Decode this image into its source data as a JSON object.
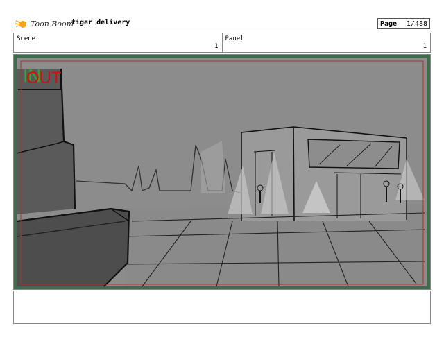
{
  "header": {
    "logo_text": "Toon Boom",
    "project_title": "tiger delivery",
    "page_label": "Page",
    "page_value": "1/488"
  },
  "info": {
    "scene_label": "Scene",
    "scene_value": "1",
    "panel_label": "Panel",
    "panel_value": "1"
  },
  "panel": {
    "in_mark": "IN",
    "out_mark": "OUT",
    "in_color": "#2ea82e",
    "out_color": "#cc1111",
    "safe_frame_color": "#b03030",
    "background_color": "#8c8c8c"
  },
  "notes": {
    "text": ""
  }
}
